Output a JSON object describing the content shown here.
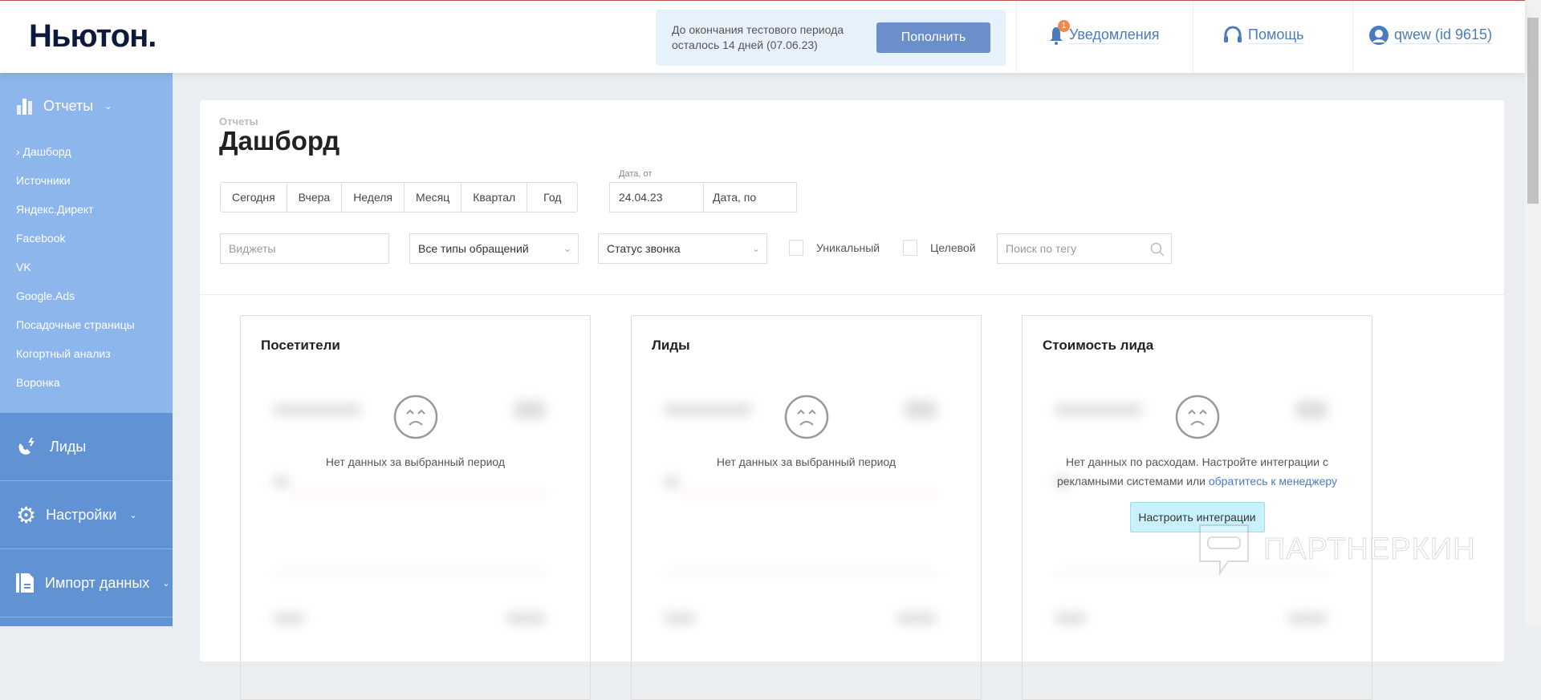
{
  "header": {
    "logo": "Ньютон.",
    "trial_line1": "До окончания тестового периода",
    "trial_line2": "осталось 14 дней (07.06.23)",
    "topup": "Пополнить",
    "notifications": "Уведомления",
    "notifications_count": "1",
    "help": "Помощь",
    "user": "qwew (id 9615)"
  },
  "sidebar": {
    "reports": "Отчеты",
    "sub": [
      "Дашборд",
      "Источники",
      "Яндекс.Директ",
      "Facebook",
      "VK",
      "Google.Ads",
      "Посадочные страницы",
      "Когортный анализ",
      "Воронка"
    ],
    "leads": "Лиды",
    "settings": "Настройки",
    "import": "Импорт данных"
  },
  "page": {
    "breadcrumb": "Отчеты",
    "title": "Дашборд",
    "periods": [
      "Сегодня",
      "Вчера",
      "Неделя",
      "Месяц",
      "Квартал",
      "Год"
    ],
    "date_from_label": "Дата, от",
    "date_from": "24.04.23",
    "date_to_placeholder": "Дата, по",
    "widgets_placeholder": "Виджеты",
    "types_select": "Все типы обращений",
    "status_select": "Статус звонка",
    "unique": "Уникальный",
    "target": "Целевой",
    "tag_search_placeholder": "Поиск по тегу"
  },
  "widgets": [
    {
      "title": "Посетители",
      "message": "Нет данных за выбранный период"
    },
    {
      "title": "Лиды",
      "message": "Нет данных за выбранный период"
    },
    {
      "title": "Стоимость лида",
      "message": "Нет данных по расходам. Настройте интеграции с рекламными системами или",
      "link": "обратитесь к менеджеру",
      "button": "Настроить интеграции"
    }
  ],
  "watermark": "ПАРТНЕРКИН"
}
